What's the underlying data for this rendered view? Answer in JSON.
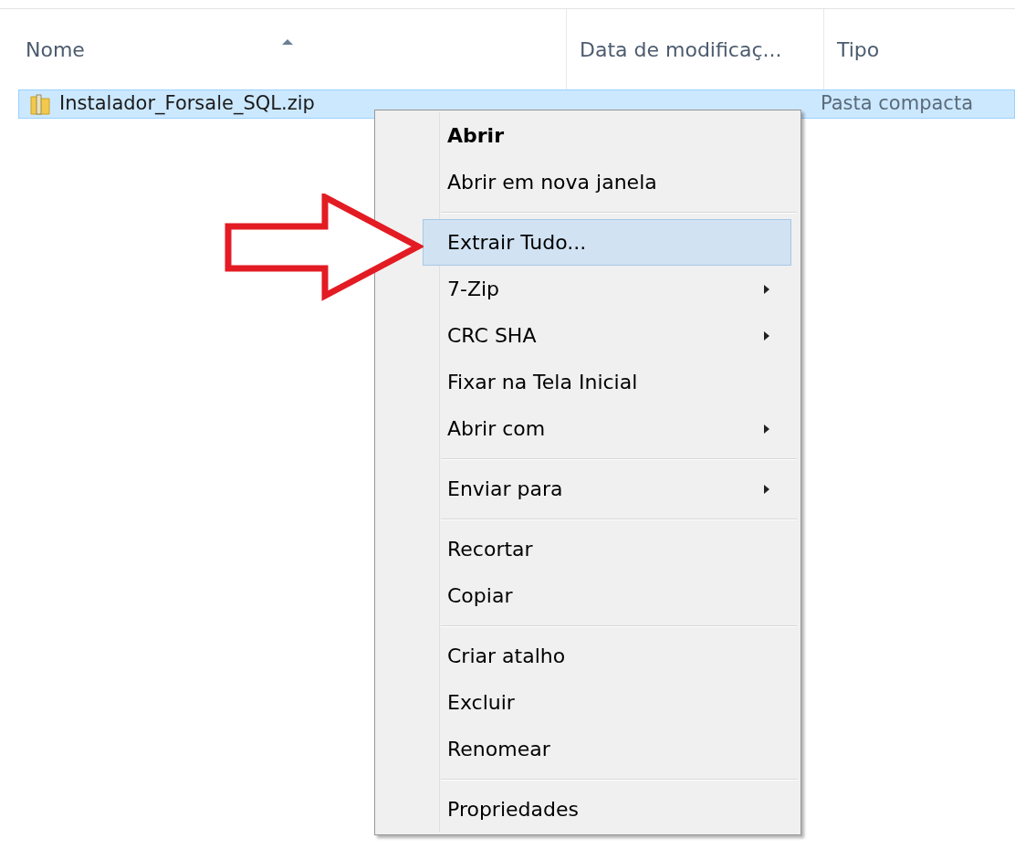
{
  "columns": [
    {
      "label": "Nome",
      "sorted": true
    },
    {
      "label": "Data de modificaç...",
      "sorted": false
    },
    {
      "label": "Tipo",
      "sorted": false
    }
  ],
  "rows": [
    {
      "name": "Instalador_Forsale_SQL.zip",
      "type": "Pasta compacta",
      "selected": true
    }
  ],
  "context_menu": {
    "items": [
      {
        "kind": "item",
        "label": "Abrir",
        "default": true,
        "submenu": false,
        "selected": false
      },
      {
        "kind": "item",
        "label": "Abrir em nova janela",
        "default": false,
        "submenu": false,
        "selected": false
      },
      {
        "kind": "separator"
      },
      {
        "kind": "item",
        "label": "Extrair Tudo...",
        "default": false,
        "submenu": false,
        "selected": true
      },
      {
        "kind": "item",
        "label": "7-Zip",
        "default": false,
        "submenu": true,
        "selected": false
      },
      {
        "kind": "item",
        "label": "CRC SHA",
        "default": false,
        "submenu": true,
        "selected": false
      },
      {
        "kind": "item",
        "label": "Fixar na Tela Inicial",
        "default": false,
        "submenu": false,
        "selected": false
      },
      {
        "kind": "item",
        "label": "Abrir com",
        "default": false,
        "submenu": true,
        "selected": false
      },
      {
        "kind": "separator"
      },
      {
        "kind": "item",
        "label": "Enviar para",
        "default": false,
        "submenu": true,
        "selected": false
      },
      {
        "kind": "separator"
      },
      {
        "kind": "item",
        "label": "Recortar",
        "default": false,
        "submenu": false,
        "selected": false
      },
      {
        "kind": "item",
        "label": "Copiar",
        "default": false,
        "submenu": false,
        "selected": false
      },
      {
        "kind": "separator"
      },
      {
        "kind": "item",
        "label": "Criar atalho",
        "default": false,
        "submenu": false,
        "selected": false
      },
      {
        "kind": "item",
        "label": "Excluir",
        "default": false,
        "submenu": false,
        "selected": false
      },
      {
        "kind": "item",
        "label": "Renomear",
        "default": false,
        "submenu": false,
        "selected": false
      },
      {
        "kind": "separator"
      },
      {
        "kind": "item",
        "label": "Propriedades",
        "default": false,
        "submenu": false,
        "selected": false
      }
    ]
  }
}
